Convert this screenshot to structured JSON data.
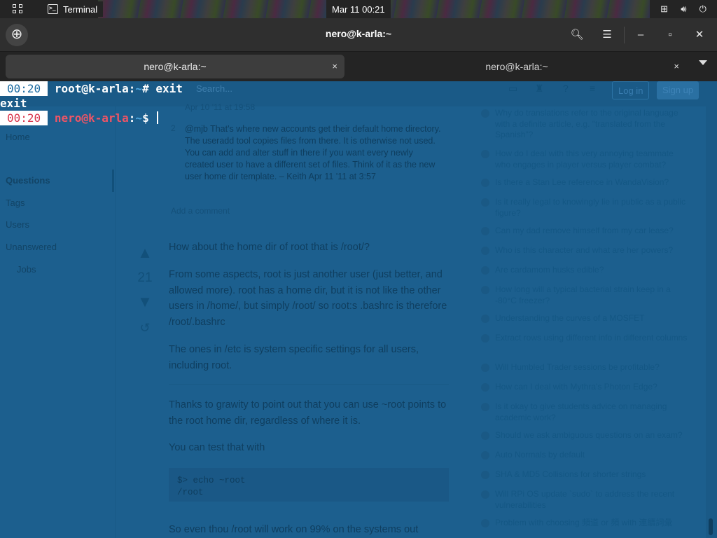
{
  "topbar": {
    "app_name": "Terminal",
    "clock": "Mar 11  00:21"
  },
  "window": {
    "title": "nero@k-arla:~",
    "tabs": [
      {
        "label": "nero@k-arla:~",
        "active": true
      },
      {
        "label": "nero@k-arla:~",
        "active": false
      }
    ],
    "close_glyph": "×"
  },
  "terminal": {
    "lines": [
      {
        "time": "00:20",
        "user_host": "root@k-arla",
        "sep": ":",
        "path": "~",
        "prompt": "#",
        "command": " exit"
      },
      {
        "output": "exit"
      },
      {
        "time": "00:20",
        "user_host": "nero@k-arla",
        "sep": ":",
        "path": "~",
        "prompt": "$",
        "command": " "
      }
    ]
  },
  "background_page": {
    "buttons": {
      "login": "Log in",
      "signup": "Sign up"
    },
    "search_placeholder": "Search...",
    "nav": [
      "Home",
      "Questions",
      "Tags",
      "Users",
      "Unanswered",
      "Jobs"
    ],
    "comment_meta": "Apr 10 '11 at 19:58",
    "comment_score": "2",
    "comment_text": "@mjb That's where new accounts get their default home directory. The useradd tool copies files from there. It is otherwise not used. You can add and alter stuff in there if you want every newly created user to have a different set of files. Think of it as the new user home dir template. – Keith Apr 11 '11 at 3:57",
    "add_comment": "Add a comment",
    "vote_count": "21",
    "answer": {
      "p1": "How about the home dir of root that is /root/?",
      "p2": "From some aspects, root is just another user (just better, and allowed more). root has a home dir, but it is not like the other users in /home/, but simply /root/ so root:s .bashrc is therefore /root/.bashrc",
      "p3": "The ones in /etc is system specific settings for all users, including root.",
      "p4": "Thanks to grawity to point out that you can use ~root points to the root home dir, regardless of where it is.",
      "p5": "You can test that with",
      "code_line1": "$> echo  ~root",
      "code_line2": "/root",
      "p6": "So even thou /root will work on 99% on the systems out"
    },
    "hot_questions": [
      "Why do translations refer to the original language with a definite article, e.g. \"translated from the Spanish\"?",
      "How do I deal with this very annoying teammate who engages in player versus player combat?",
      "Is there a Stan Lee reference in WandaVision?",
      "Is it really legal to knowingly lie in public as a public figure?",
      "Can my dad remove himself from my car lease?",
      "Who is this character and what are her powers?",
      "Are cardamom husks edible?",
      "How long will a typical bacterial strain keep in a -80°C freezer?",
      "Understanding the curves of a MOSFET",
      "Extract rows using different info in different columns",
      "Will Humbled Trader sessions be profitable?",
      "How can I deal with Mythra's Photon Edge?",
      "Is it okay to give students advice on managing academic work?",
      "Should we ask ambiguous questions on an exam?",
      "Auto Normals by default",
      "SHA & MD5 Collisions for shorter strings",
      "Will RPi OS update `sudo` to address the recent vulnerabilities",
      "Problem with choosing 頻道 or 頻 with 連續詞彙"
    ]
  }
}
